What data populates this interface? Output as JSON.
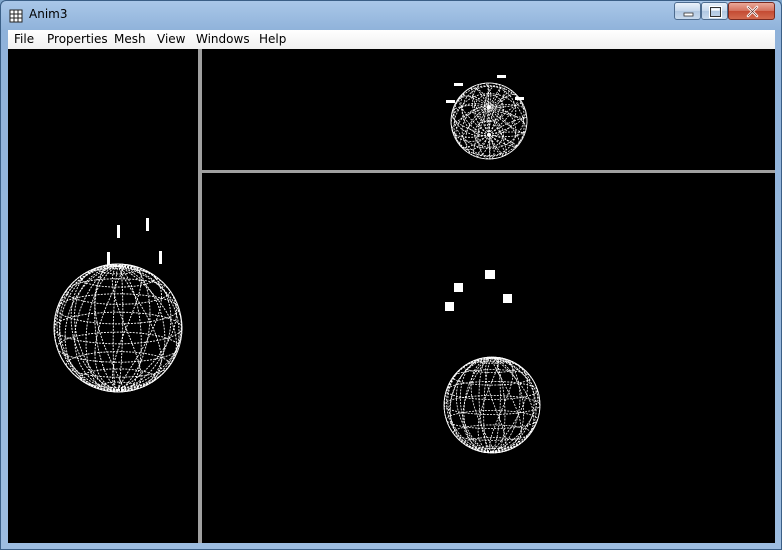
{
  "window": {
    "title": "Anim3",
    "icons": {
      "app": "grid-app-icon",
      "minimize": "minimize-icon",
      "maximize": "maximize-icon",
      "close": "close-icon"
    }
  },
  "menu": {
    "items": [
      {
        "id": "file",
        "label": "File"
      },
      {
        "id": "properties",
        "label": "Properties"
      },
      {
        "id": "mesh",
        "label": "Mesh"
      },
      {
        "id": "view",
        "label": "View"
      },
      {
        "id": "windows",
        "label": "Windows"
      },
      {
        "id": "help",
        "label": "Help"
      }
    ]
  },
  "viewports": [
    {
      "id": "left",
      "content": "wireframe-sphere"
    },
    {
      "id": "top",
      "content": "wireframe-sphere"
    },
    {
      "id": "perspective",
      "content": "wireframe-sphere"
    }
  ],
  "colors": {
    "viewport_background": "#000000",
    "wireframe": "#ffffff",
    "divider": "#a0a0a0"
  }
}
